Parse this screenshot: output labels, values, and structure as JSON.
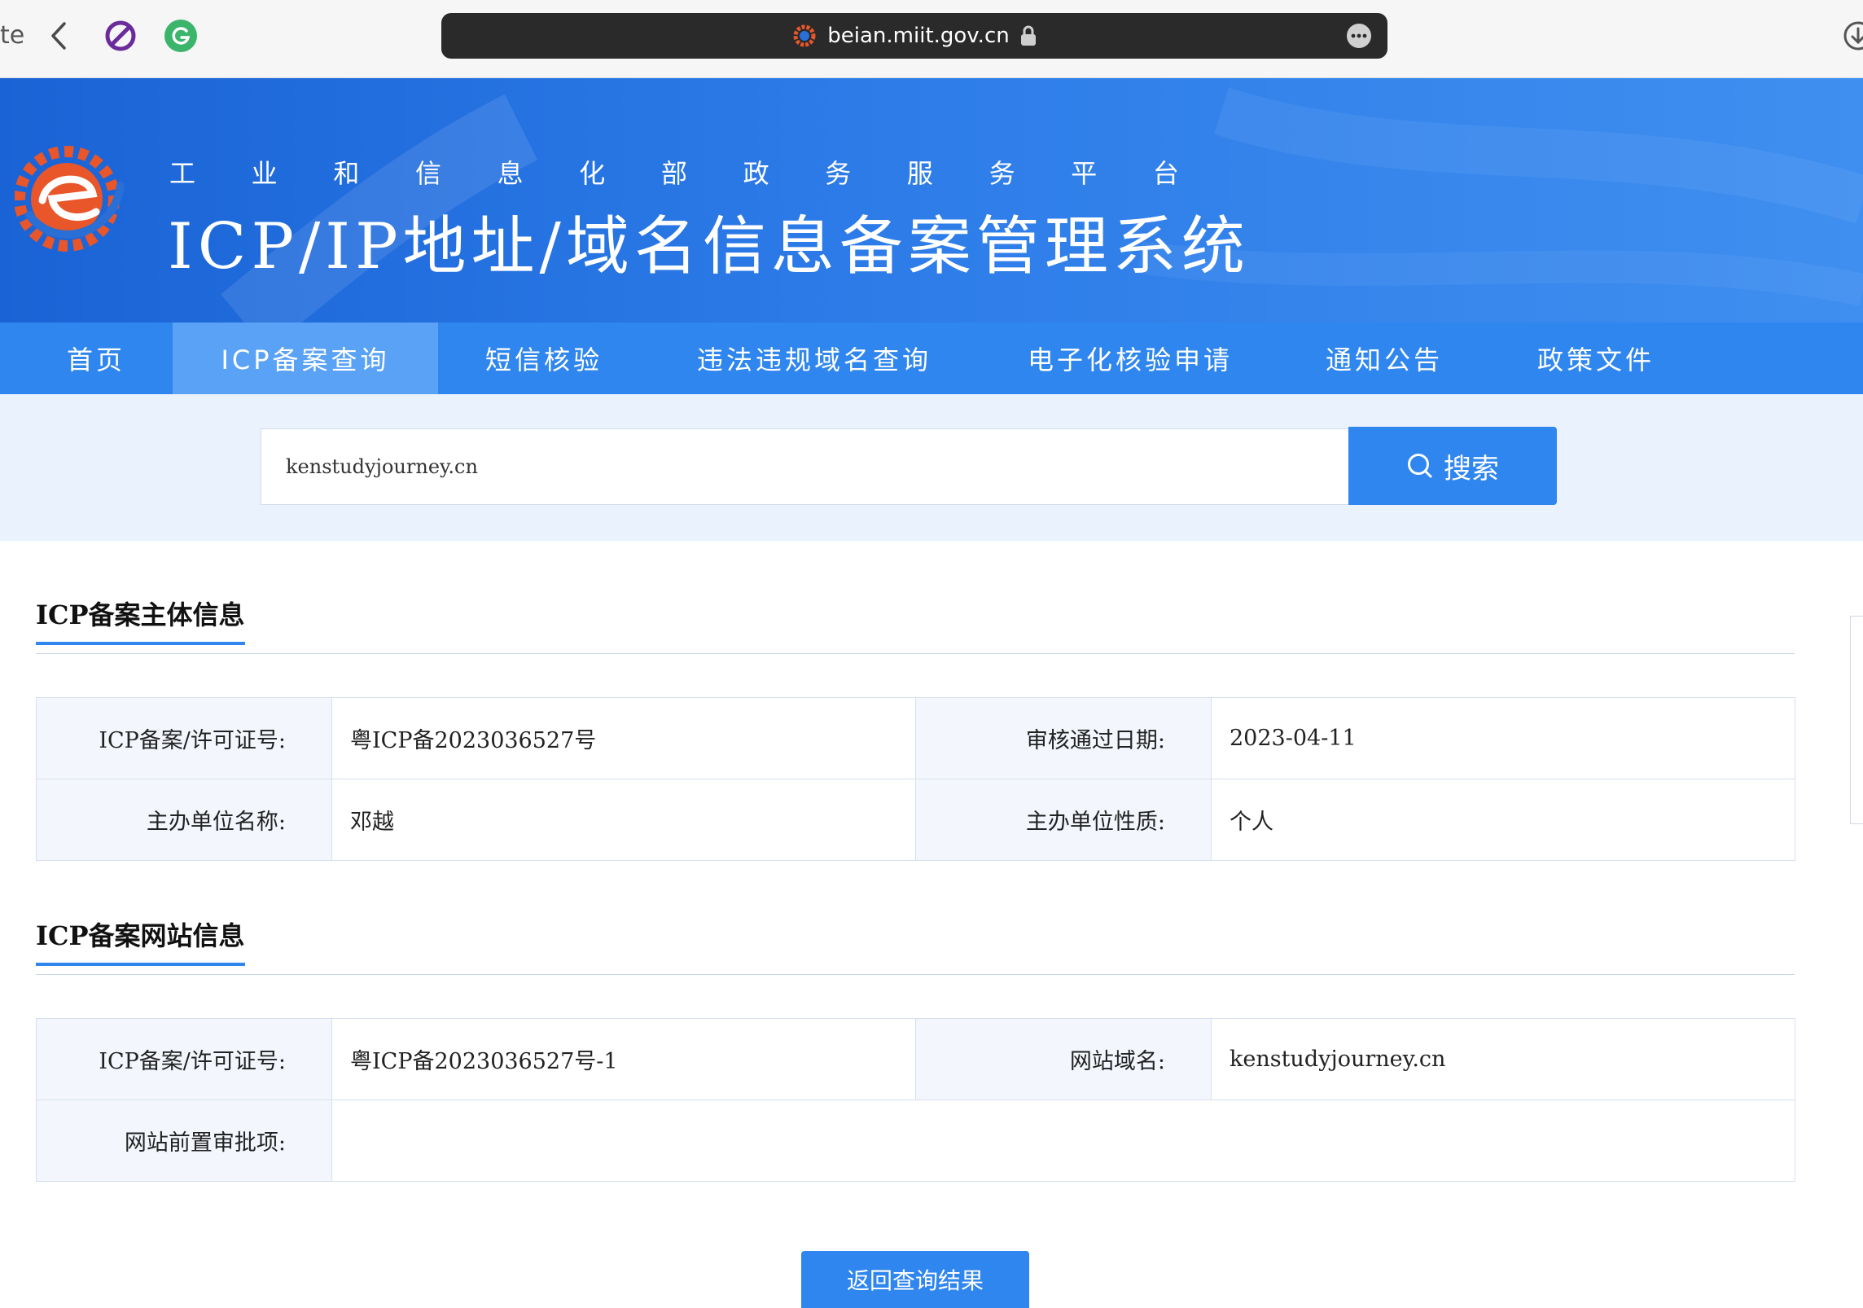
{
  "browser": {
    "tab_fragment": "te",
    "url": "beian.miit.gov.cn"
  },
  "banner": {
    "subtitle_chars": [
      "工",
      "业",
      "和",
      "信",
      "息",
      "化",
      "部",
      "政",
      "务",
      "服",
      "务",
      "平",
      "台"
    ],
    "title": "ICP/IP地址/域名信息备案管理系统"
  },
  "nav": {
    "items": [
      "首页",
      "ICP备案查询",
      "短信核验",
      "违法违规域名查询",
      "电子化核验申请",
      "通知公告",
      "政策文件"
    ],
    "active_index": 1
  },
  "search": {
    "value": "kenstudyjourney.cn",
    "button_label": "搜索"
  },
  "entity_section": {
    "title": "ICP备案主体信息",
    "rows": [
      {
        "label1": "ICP备案/许可证号:",
        "value1": "粤ICP备2023036527号",
        "label2": "审核通过日期:",
        "value2": "2023-04-11"
      },
      {
        "label1": "主办单位名称:",
        "value1": "邓越",
        "label2": "主办单位性质:",
        "value2": "个人"
      }
    ]
  },
  "website_section": {
    "title": "ICP备案网站信息",
    "license_label": "ICP备案/许可证号:",
    "license_value": "粤ICP备2023036527号-1",
    "domain_label": "网站域名:",
    "domain_value": "kenstudyjourney.cn",
    "approval_label": "网站前置审批项:",
    "approval_value": ""
  },
  "footer": {
    "back_button_label": "返回查询结果"
  },
  "colors": {
    "primary": "#2f86ee",
    "nav_active": "#5aa2f5",
    "search_bg": "#e9f2fd",
    "label_bg": "#f3f7fd",
    "logo_orange": "#e8562a"
  }
}
